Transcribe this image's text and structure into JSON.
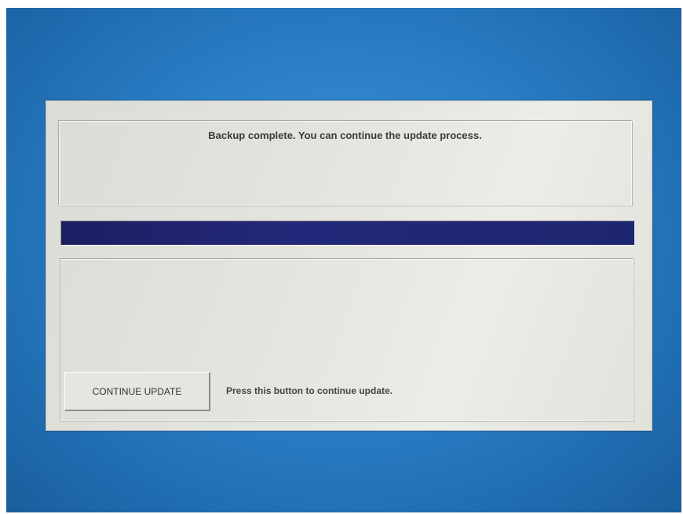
{
  "dialog": {
    "message": "Backup complete. You can continue the update process.",
    "progress": 1.0,
    "progress_color": "#1e2570",
    "continue_button_label": "CONTINUE UPDATE",
    "continue_hint": "Press this button to continue update."
  },
  "colors": {
    "desktop_background": "#2a7fc6",
    "dialog_background": "#e4e4de"
  }
}
